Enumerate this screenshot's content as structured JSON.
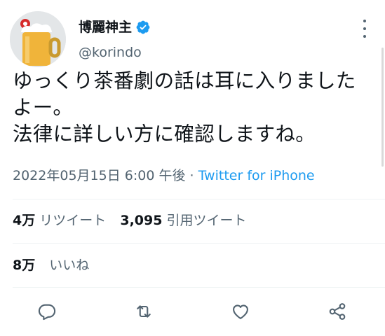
{
  "author": {
    "display_name": "博麗神主",
    "handle": "@korindo",
    "avatar_icon": "beer-mug-avatar",
    "verified_icon": "verified-badge-icon"
  },
  "tweet": {
    "text": "ゆっくり茶番劇の話は耳に入りました よー。\n法律に詳しい方に確認しますね。",
    "timestamp": "2022年05月15日 6:00 午後",
    "separator": "·",
    "source": "Twitter for iPhone"
  },
  "stats": {
    "retweets_count": "4万",
    "retweets_label": "リツイート",
    "quotes_count": "3,095",
    "quotes_label": "引用ツイート",
    "likes_count": "8万",
    "likes_label": "いいね"
  },
  "actions": [
    "reply-icon",
    "retweet-icon",
    "like-icon",
    "share-icon"
  ],
  "colors": {
    "accent": "#1d9bf0",
    "text_primary": "#0f1419",
    "text_secondary": "#536471",
    "divider": "#eff3f4"
  }
}
